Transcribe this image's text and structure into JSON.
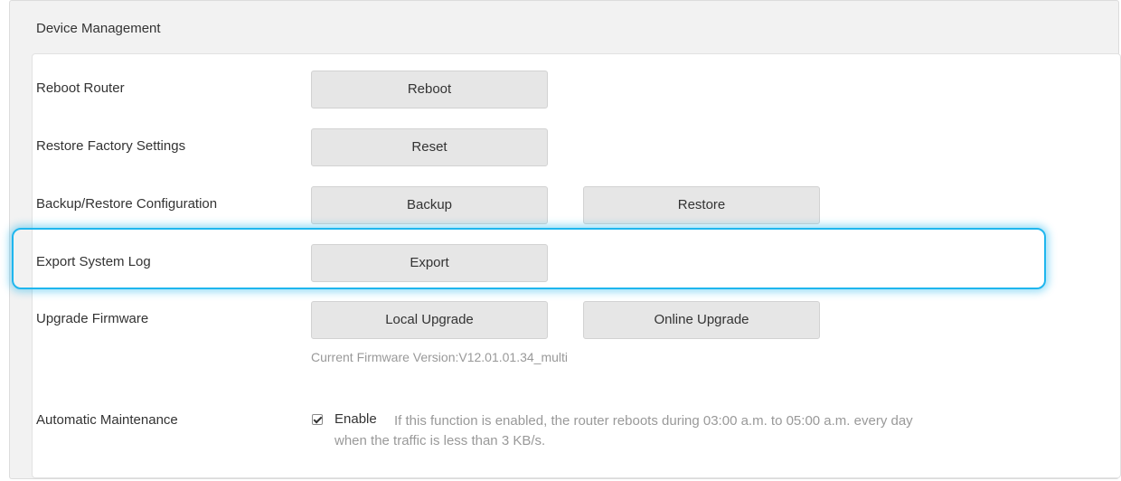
{
  "panel": {
    "title": "Device Management"
  },
  "rows": {
    "reboot": {
      "label": "Reboot Router",
      "button": "Reboot"
    },
    "reset": {
      "label": "Restore Factory Settings",
      "button": "Reset"
    },
    "backup": {
      "label": "Backup/Restore Configuration",
      "backup_button": "Backup",
      "restore_button": "Restore"
    },
    "export_log": {
      "label": "Export System Log",
      "button": "Export",
      "highlighted": true
    },
    "firmware": {
      "label": "Upgrade Firmware",
      "local_button": "Local Upgrade",
      "online_button": "Online Upgrade",
      "version_text": "Current Firmware Version:V12.01.01.34_multi"
    },
    "maintenance": {
      "label": "Automatic Maintenance",
      "checkbox_checked": true,
      "enable_label": "Enable",
      "description": "If this function is enabled, the router reboots during 03:00 a.m. to 05:00 a.m. every day when the traffic is less than 3 KB/s."
    }
  },
  "colors": {
    "panel_bg": "#f2f2f2",
    "button_bg": "#e6e6e6",
    "highlight": "#1fb6ee",
    "muted_text": "#999999"
  }
}
